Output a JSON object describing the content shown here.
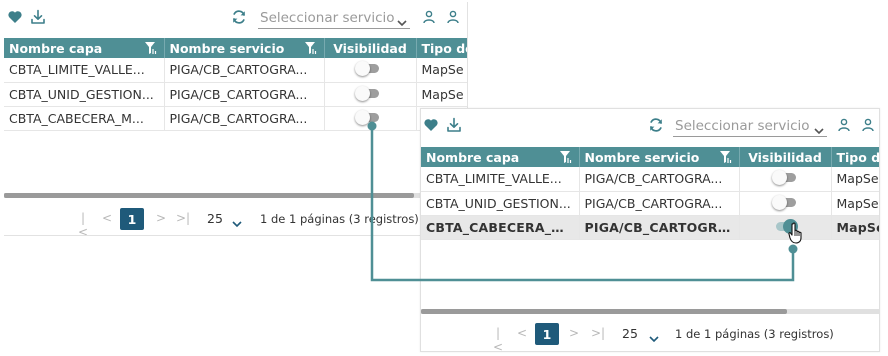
{
  "service_select": {
    "placeholder": "Seleccionar servicio"
  },
  "table": {
    "columns": [
      "Nombre capa",
      "Nombre servicio",
      "Visibilidad",
      "Tipo de"
    ],
    "rows": [
      {
        "layer": "CBTA_LIMITE_VALLE...",
        "service": "PIGA/CB_CARTOGRA...",
        "type": "MapSe"
      },
      {
        "layer": "CBTA_UNID_GESTION...",
        "service": "PIGA/CB_CARTOGRA...",
        "type": "MapSe"
      },
      {
        "layer": "CBTA_CABECERA_M...",
        "service": "PIGA/CB_CARTOGRA...",
        "type": "MapSe"
      }
    ],
    "front_rows": [
      {
        "layer": "CBTA_LIMITE_VALLE...",
        "service": "PIGA/CB_CARTOGRA...",
        "type": "MapSe",
        "visible": false
      },
      {
        "layer": "CBTA_UNID_GESTION...",
        "service": "PIGA/CB_CARTOGRA...",
        "type": "MapSe",
        "visible": false
      },
      {
        "layer": "CBTA_CABECERA_M...",
        "service": "PIGA/CB_CARTOGRAF...",
        "type": "MapSe",
        "visible": true
      }
    ]
  },
  "pagination": {
    "first": "|<",
    "prev": "<",
    "current": "1",
    "next": ">",
    "last": ">|",
    "page_size": "25",
    "info": "1 de 1 páginas (3 registros)"
  },
  "colors": {
    "accent": "#4f8f95",
    "page_active": "#1f5a7a",
    "toggle_on": "#4f8f95",
    "toggle_off": "#9e9e9e"
  },
  "icons": [
    "heart-icon",
    "download-icon",
    "refresh-icon",
    "chevron-down-icon",
    "user-icon",
    "filter-icon",
    "hand-cursor-icon"
  ]
}
